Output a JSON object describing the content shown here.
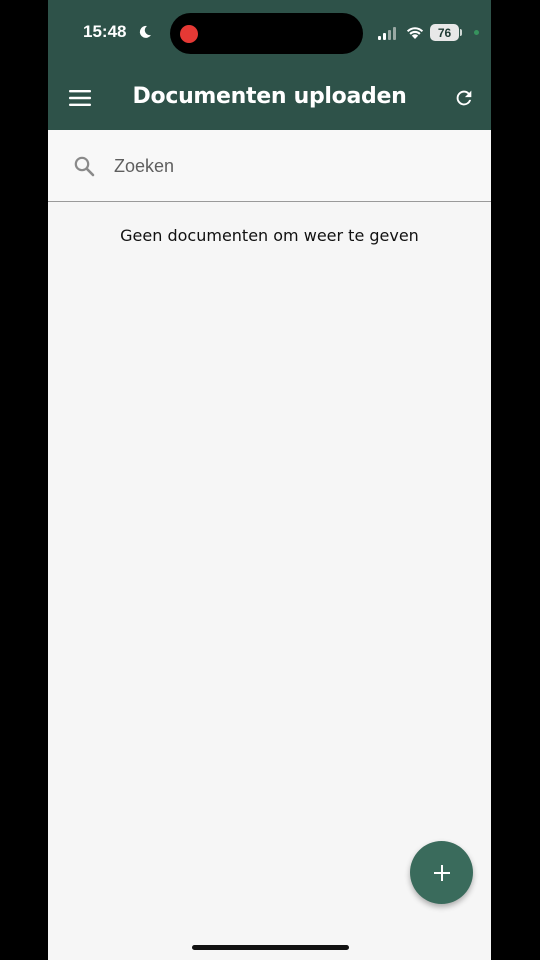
{
  "status_bar": {
    "time": "15:48",
    "battery": "76",
    "icons": [
      "moon-icon",
      "signal-icon",
      "wifi-icon",
      "battery-icon"
    ],
    "recording_color": "#e53935"
  },
  "app_bar": {
    "title": "Documenten uploaden",
    "menu_icon": "hamburger-menu-icon",
    "refresh_icon": "refresh-icon",
    "background": "#2e5249"
  },
  "search": {
    "placeholder": "Zoeken",
    "value": "",
    "icon": "search-icon"
  },
  "content": {
    "empty_message": "Geen documenten om weer te geven"
  },
  "fab": {
    "icon": "plus-icon",
    "color": "#3a6b5c"
  }
}
